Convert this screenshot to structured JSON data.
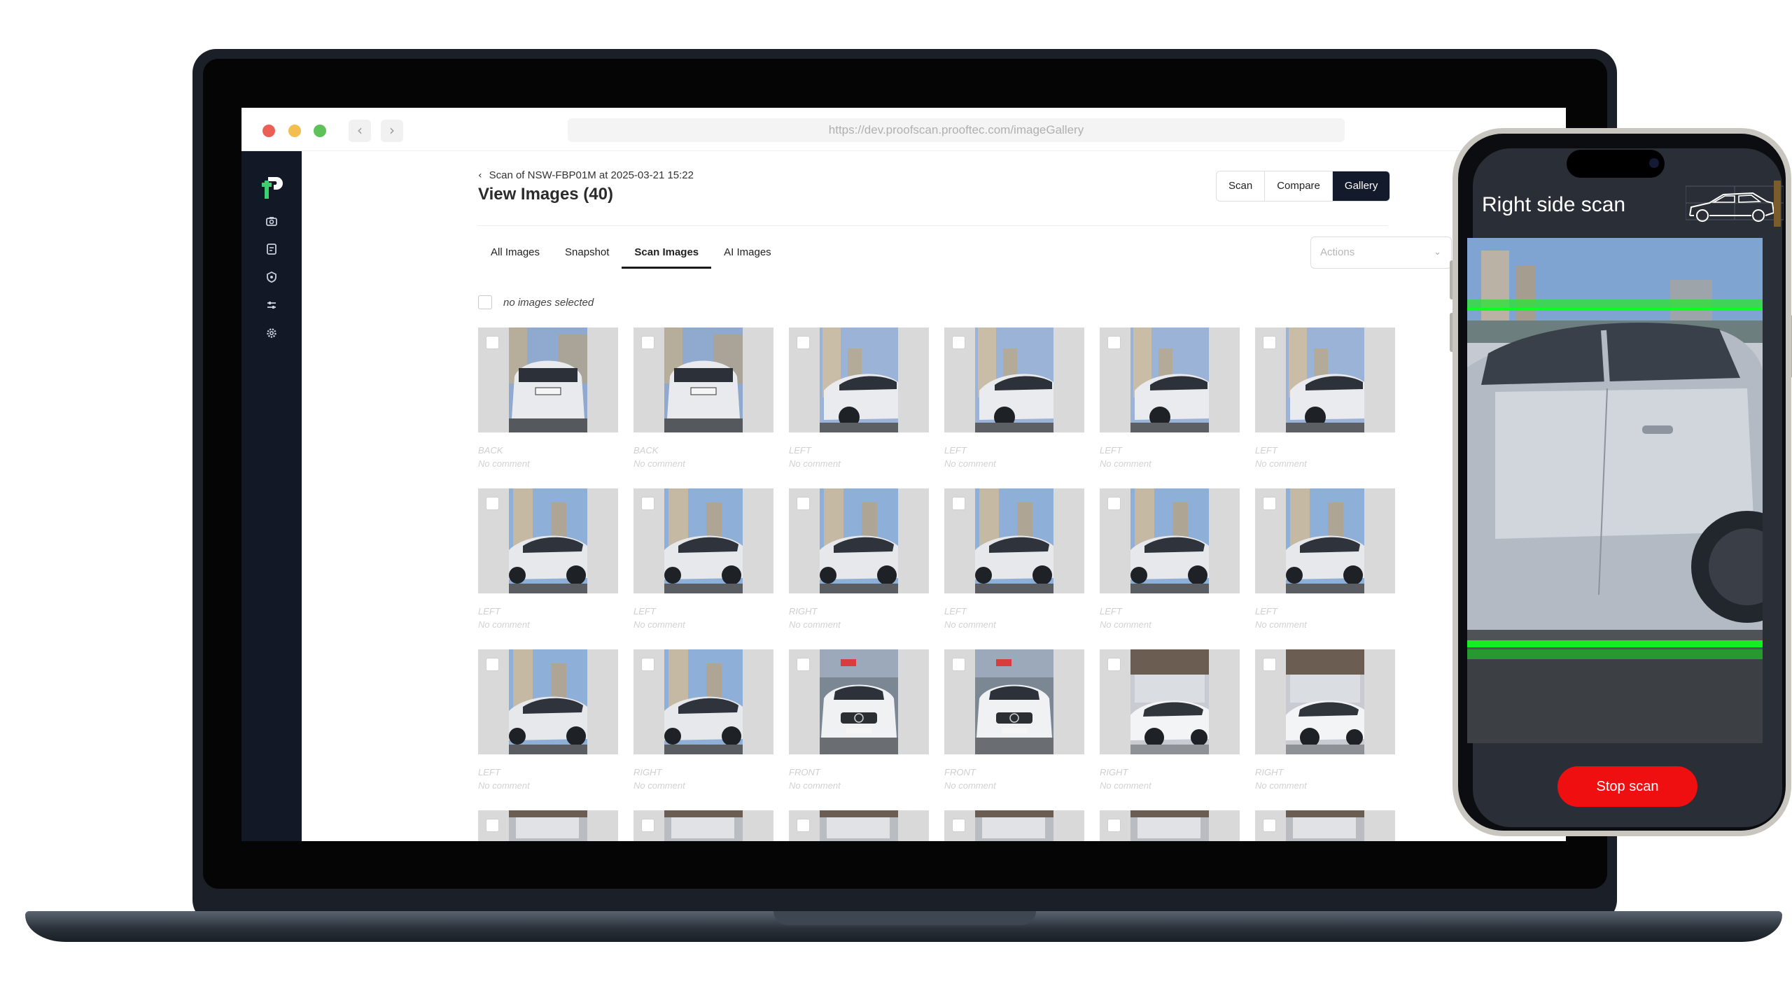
{
  "browser": {
    "url": "https://dev.proofscan.prooftec.com/imageGallery",
    "back_icon": "chevron-left-icon",
    "forward_icon": "chevron-right-icon"
  },
  "sidebar": {
    "logo": "proofscan-logo",
    "icons": [
      "camera-icon",
      "document-icon",
      "shield-icon",
      "sliders-icon",
      "gear-icon"
    ]
  },
  "header": {
    "breadcrumb": "Scan of NSW-FBP01M at 2025-03-21 15:22",
    "title": "View Images (40)",
    "view_buttons": [
      {
        "label": "Scan",
        "active": false
      },
      {
        "label": "Compare",
        "active": false
      },
      {
        "label": "Gallery",
        "active": true
      }
    ]
  },
  "tabs": [
    {
      "label": "All Images",
      "active": false
    },
    {
      "label": "Snapshot",
      "active": false
    },
    {
      "label": "Scan Images",
      "active": true
    },
    {
      "label": "AI Images",
      "active": false
    }
  ],
  "actions": {
    "placeholder": "Actions"
  },
  "selection": {
    "text": "no images selected"
  },
  "gallery": {
    "rows": [
      [
        {
          "label": "BACK",
          "comment": "No comment",
          "view": "back"
        },
        {
          "label": "BACK",
          "comment": "No comment",
          "view": "back"
        },
        {
          "label": "LEFT",
          "comment": "No comment",
          "view": "left"
        },
        {
          "label": "LEFT",
          "comment": "No comment",
          "view": "left"
        },
        {
          "label": "LEFT",
          "comment": "No comment",
          "view": "left"
        },
        {
          "label": "LEFT",
          "comment": "No comment",
          "view": "left"
        }
      ],
      [
        {
          "label": "LEFT",
          "comment": "No comment",
          "view": "side"
        },
        {
          "label": "LEFT",
          "comment": "No comment",
          "view": "side"
        },
        {
          "label": "RIGHT",
          "comment": "No comment",
          "view": "side"
        },
        {
          "label": "LEFT",
          "comment": "No comment",
          "view": "side"
        },
        {
          "label": "LEFT",
          "comment": "No comment",
          "view": "side"
        },
        {
          "label": "LEFT",
          "comment": "No comment",
          "view": "side"
        }
      ],
      [
        {
          "label": "LEFT",
          "comment": "No comment",
          "view": "side"
        },
        {
          "label": "RIGHT",
          "comment": "No comment",
          "view": "side"
        },
        {
          "label": "FRONT",
          "comment": "No comment",
          "view": "front"
        },
        {
          "label": "FRONT",
          "comment": "No comment",
          "view": "front"
        },
        {
          "label": "RIGHT",
          "comment": "No comment",
          "view": "garage"
        },
        {
          "label": "RIGHT",
          "comment": "No comment",
          "view": "garage"
        }
      ],
      [
        {
          "label": "",
          "comment": "",
          "view": "partial"
        },
        {
          "label": "",
          "comment": "",
          "view": "partial"
        },
        {
          "label": "",
          "comment": "",
          "view": "partial"
        },
        {
          "label": "",
          "comment": "",
          "view": "partial"
        },
        {
          "label": "",
          "comment": "",
          "view": "partial"
        },
        {
          "label": "",
          "comment": "",
          "view": "partial"
        }
      ]
    ]
  },
  "phone": {
    "title": "Right side scan",
    "stop_label": "Stop scan",
    "scan_line_color": "#22e02a",
    "stop_color": "#f00f10"
  },
  "colors": {
    "sidebar_bg": "#121826",
    "active_button_bg": "#131a2b",
    "laptop_frame": "#1b1f27"
  }
}
